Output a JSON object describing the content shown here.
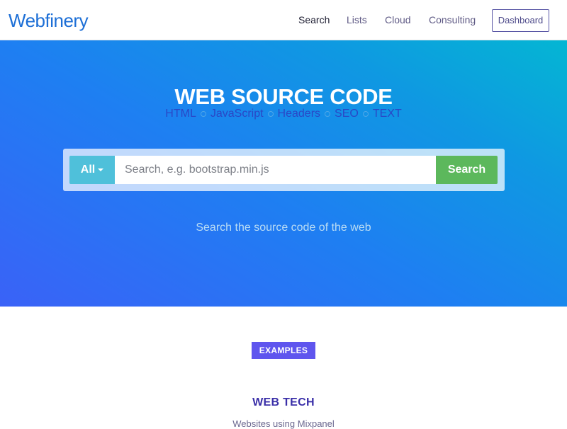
{
  "brand": {
    "logo_text": "Webfinery",
    "accent_color": "#1d6fd6"
  },
  "nav": {
    "links": [
      {
        "label": "Search",
        "active": true
      },
      {
        "label": "Lists",
        "active": false
      },
      {
        "label": "Cloud",
        "active": false
      },
      {
        "label": "Consulting",
        "active": false
      }
    ],
    "dashboard_label": "Dashboard"
  },
  "hero": {
    "title": "WEB SOURCE CODE",
    "tags": [
      "HTML",
      "JavaScript",
      "Headers",
      "SEO",
      "TEXT"
    ],
    "search": {
      "scope_label": "All",
      "placeholder": "Search, e.g. bootstrap.min.js",
      "value": "",
      "button_label": "Search"
    },
    "subtitle": "Search the source code of the web"
  },
  "examples": {
    "badge": "EXAMPLES",
    "title": "WEB TECH",
    "subtitle": "Websites using Mixpanel"
  },
  "colors": {
    "search_button": "#5cb85c",
    "scope_button": "#4fc0da",
    "examples_badge": "#5f55ee"
  }
}
